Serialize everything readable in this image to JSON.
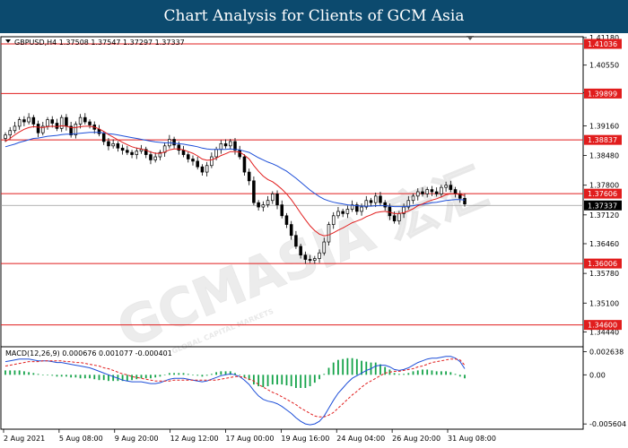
{
  "banner": {
    "title": "Chart Analysis for Clients of GCM Asia"
  },
  "watermark": {
    "text": "GCMASIA 宏汇",
    "subtext": "GLOBAL CAPITAL MARKETS"
  },
  "colors": {
    "level_line": "#e11d1d",
    "price_tag": "#e11d1d",
    "current_tag": "#000000",
    "ma_fast": "#e11d1d",
    "ma_slow": "#1d4ed8",
    "macd_line": "#1d4ed8",
    "signal_line": "#e11d1d",
    "histogram": "#16a34a",
    "candles": "#000000",
    "banner_bg": "#0c4a6e"
  },
  "chart_data": [
    {
      "type": "candlestick",
      "header": "GBPUSD,H4  1.37508 1.37547 1.37297 1.37337",
      "symbol": "GBPUSD",
      "timeframe": "H4",
      "ohlc_readout": {
        "open": 1.37508,
        "high": 1.37547,
        "low": 1.37297,
        "close": 1.37337
      },
      "ylim": [
        1.341,
        1.412
      ],
      "y_ticks": [
        "1.41180",
        "1.40550",
        "1.39920",
        "1.39160",
        "1.38480",
        "1.37800",
        "1.37120",
        "1.36460",
        "1.35780",
        "1.35100",
        "1.34440"
      ],
      "x_ticks": [
        "2 Aug 2021",
        "5 Aug 08:00",
        "9 Aug 20:00",
        "12 Aug 12:00",
        "17 Aug 00:00",
        "19 Aug 16:00",
        "24 Aug 04:00",
        "26 Aug 20:00",
        "31 Aug 08:00"
      ],
      "levels": [
        "1.41036",
        "1.39899",
        "1.38837",
        "1.37606",
        "1.36006",
        "1.34600"
      ],
      "current_price": "1.37337",
      "closes": [
        1.3895,
        1.3905,
        1.3915,
        1.393,
        1.3925,
        1.3935,
        1.392,
        1.39,
        1.3915,
        1.393,
        1.3922,
        1.391,
        1.3935,
        1.3915,
        1.3895,
        1.392,
        1.3935,
        1.3925,
        1.3918,
        1.3908,
        1.3898,
        1.388,
        1.387,
        1.3875,
        1.3865,
        1.386,
        1.3855,
        1.385,
        1.3858,
        1.3862,
        1.385,
        1.3838,
        1.3845,
        1.3855,
        1.387,
        1.3885,
        1.3872,
        1.386,
        1.385,
        1.384,
        1.3835,
        1.3822,
        1.381,
        1.3825,
        1.3845,
        1.3862,
        1.3875,
        1.387,
        1.388,
        1.386,
        1.3845,
        1.381,
        1.379,
        1.374,
        1.373,
        1.3735,
        1.3745,
        1.376,
        1.3735,
        1.371,
        1.369,
        1.3665,
        1.364,
        1.362,
        1.361,
        1.3608,
        1.3612,
        1.3625,
        1.365,
        1.369,
        1.371,
        1.372,
        1.3715,
        1.3725,
        1.3735,
        1.372,
        1.373,
        1.3745,
        1.374,
        1.3755,
        1.374,
        1.373,
        1.371,
        1.3698,
        1.3715,
        1.373,
        1.3745,
        1.3755,
        1.3765,
        1.376,
        1.377,
        1.3765,
        1.376,
        1.3775,
        1.378,
        1.377,
        1.376,
        1.375,
        1.3737
      ],
      "ma_fast": [
        1.388,
        1.3887,
        1.3895,
        1.3902,
        1.3908,
        1.3912,
        1.3914,
        1.3913,
        1.3912,
        1.3914,
        1.3915,
        1.3914,
        1.3916,
        1.3915,
        1.3912,
        1.3912,
        1.3914,
        1.3915,
        1.3915,
        1.3913,
        1.3909,
        1.3903,
        1.3896,
        1.389,
        1.3884,
        1.3878,
        1.3873,
        1.3868,
        1.3865,
        1.3863,
        1.386,
        1.3856,
        1.3853,
        1.3853,
        1.3856,
        1.3861,
        1.3863,
        1.3863,
        1.3861,
        1.3857,
        1.3853,
        1.3847,
        1.384,
        1.3837,
        1.3838,
        1.3842,
        1.3848,
        1.3852,
        1.3857,
        1.3857,
        1.3856,
        1.3849,
        1.384,
        1.3825,
        1.3812,
        1.3801,
        1.3793,
        1.3788,
        1.378,
        1.3771,
        1.376,
        1.3747,
        1.3732,
        1.3716,
        1.3701,
        1.3687,
        1.3676,
        1.3668,
        1.3664,
        1.3666,
        1.3671,
        1.3677,
        1.3682,
        1.3688,
        1.3694,
        1.3698,
        1.3702,
        1.3708,
        1.3712,
        1.3717,
        1.3719,
        1.372,
        1.3718,
        1.3715,
        1.3715,
        1.3717,
        1.3721,
        1.3726,
        1.3733,
        1.3737,
        1.3742,
        1.3746,
        1.3749,
        1.3753,
        1.3758,
        1.376,
        1.376,
        1.3759,
        1.3756
      ],
      "ma_slow": [
        1.3868,
        1.3871,
        1.3874,
        1.3878,
        1.3881,
        1.3884,
        1.3887,
        1.3888,
        1.389,
        1.3892,
        1.3893,
        1.3894,
        1.3896,
        1.3897,
        1.3897,
        1.3898,
        1.3899,
        1.39,
        1.3901,
        1.3901,
        1.3901,
        1.39,
        1.3898,
        1.3897,
        1.3895,
        1.3893,
        1.3891,
        1.3889,
        1.3887,
        1.3885,
        1.3883,
        1.3881,
        1.3879,
        1.3878,
        1.3877,
        1.3877,
        1.3876,
        1.3875,
        1.3874,
        1.3872,
        1.387,
        1.3868,
        1.3865,
        1.3863,
        1.3862,
        1.3862,
        1.3862,
        1.3862,
        1.3863,
        1.3862,
        1.3861,
        1.3858,
        1.3855,
        1.3849,
        1.3843,
        1.3838,
        1.3833,
        1.3829,
        1.3824,
        1.3818,
        1.3812,
        1.3804,
        1.3796,
        1.3787,
        1.3778,
        1.3769,
        1.3761,
        1.3754,
        1.3748,
        1.3744,
        1.3741,
        1.3739,
        1.3737,
        1.3735,
        1.3734,
        1.3733,
        1.3732,
        1.3732,
        1.3732,
        1.3733,
        1.3733,
        1.3733,
        1.3732,
        1.3731,
        1.3731,
        1.3731,
        1.3732,
        1.3733,
        1.3735,
        1.3736,
        1.3738,
        1.374,
        1.3741,
        1.3743,
        1.3745,
        1.3746,
        1.3747,
        1.3747,
        1.3746
      ]
    },
    {
      "type": "macd",
      "header": "MACD(12,26,9) 0.000676 0.001077 -0.000401",
      "params": "12,26,9",
      "readout": {
        "macd": 0.000676,
        "signal": 0.001077,
        "histogram": -0.000401
      },
      "ylim": [
        -0.0062,
        0.0032
      ],
      "y_ticks": [
        "0.002638",
        "0.00",
        "-0.005604"
      ],
      "macd": [
        0.0015,
        0.0016,
        0.0017,
        0.0018,
        0.0018,
        0.0018,
        0.0017,
        0.0016,
        0.0016,
        0.0016,
        0.0015,
        0.0014,
        0.0014,
        0.0013,
        0.0012,
        0.0011,
        0.001,
        0.0009,
        0.0008,
        0.0006,
        0.0004,
        0.0002,
        0.0,
        -0.0002,
        -0.0004,
        -0.0006,
        -0.0007,
        -0.0008,
        -0.0008,
        -0.0008,
        -0.0009,
        -0.001,
        -0.001,
        -0.0009,
        -0.0007,
        -0.0005,
        -0.0004,
        -0.0004,
        -0.0004,
        -0.0005,
        -0.0006,
        -0.0007,
        -0.0008,
        -0.0007,
        -0.0005,
        -0.0003,
        -0.0001,
        0.0,
        0.0001,
        0.0,
        -0.0002,
        -0.0006,
        -0.0011,
        -0.0018,
        -0.0024,
        -0.0028,
        -0.003,
        -0.0031,
        -0.0033,
        -0.0036,
        -0.004,
        -0.0044,
        -0.0049,
        -0.0053,
        -0.0056,
        -0.0057,
        -0.0056,
        -0.0053,
        -0.0047,
        -0.0038,
        -0.0029,
        -0.0021,
        -0.0015,
        -0.0009,
        -0.0004,
        -0.0001,
        0.0002,
        0.0005,
        0.0007,
        0.001,
        0.0011,
        0.0011,
        0.0009,
        0.0006,
        0.0005,
        0.0006,
        0.0008,
        0.0011,
        0.0014,
        0.0016,
        0.0018,
        0.0019,
        0.0019,
        0.002,
        0.0021,
        0.0021,
        0.0019,
        0.0015,
        0.0007
      ],
      "signal": [
        0.001,
        0.0011,
        0.0012,
        0.0013,
        0.0014,
        0.0015,
        0.0015,
        0.0015,
        0.0016,
        0.0016,
        0.0016,
        0.0016,
        0.0016,
        0.0015,
        0.0015,
        0.0014,
        0.0014,
        0.0013,
        0.0012,
        0.0011,
        0.001,
        0.0008,
        0.0007,
        0.0005,
        0.0003,
        0.0001,
        0.0,
        -0.0002,
        -0.0003,
        -0.0004,
        -0.0005,
        -0.0006,
        -0.0007,
        -0.0007,
        -0.0007,
        -0.0007,
        -0.0006,
        -0.0006,
        -0.0006,
        -0.0006,
        -0.0006,
        -0.0006,
        -0.0006,
        -0.0006,
        -0.0006,
        -0.0006,
        -0.0005,
        -0.0004,
        -0.0003,
        -0.0002,
        -0.0002,
        -0.0003,
        -0.0005,
        -0.0007,
        -0.0011,
        -0.0014,
        -0.0017,
        -0.002,
        -0.0022,
        -0.0025,
        -0.0028,
        -0.0031,
        -0.0034,
        -0.0038,
        -0.0041,
        -0.0044,
        -0.0047,
        -0.0048,
        -0.0048,
        -0.0046,
        -0.0043,
        -0.0038,
        -0.0033,
        -0.0028,
        -0.0023,
        -0.0019,
        -0.0014,
        -0.001,
        -0.0007,
        -0.0004,
        -0.0001,
        0.0002,
        0.0003,
        0.0004,
        0.0004,
        0.0005,
        0.0006,
        0.0007,
        0.0009,
        0.001,
        0.0012,
        0.0014,
        0.0015,
        0.0016,
        0.0017,
        0.0018,
        0.0018,
        0.0017,
        0.0011
      ]
    }
  ]
}
